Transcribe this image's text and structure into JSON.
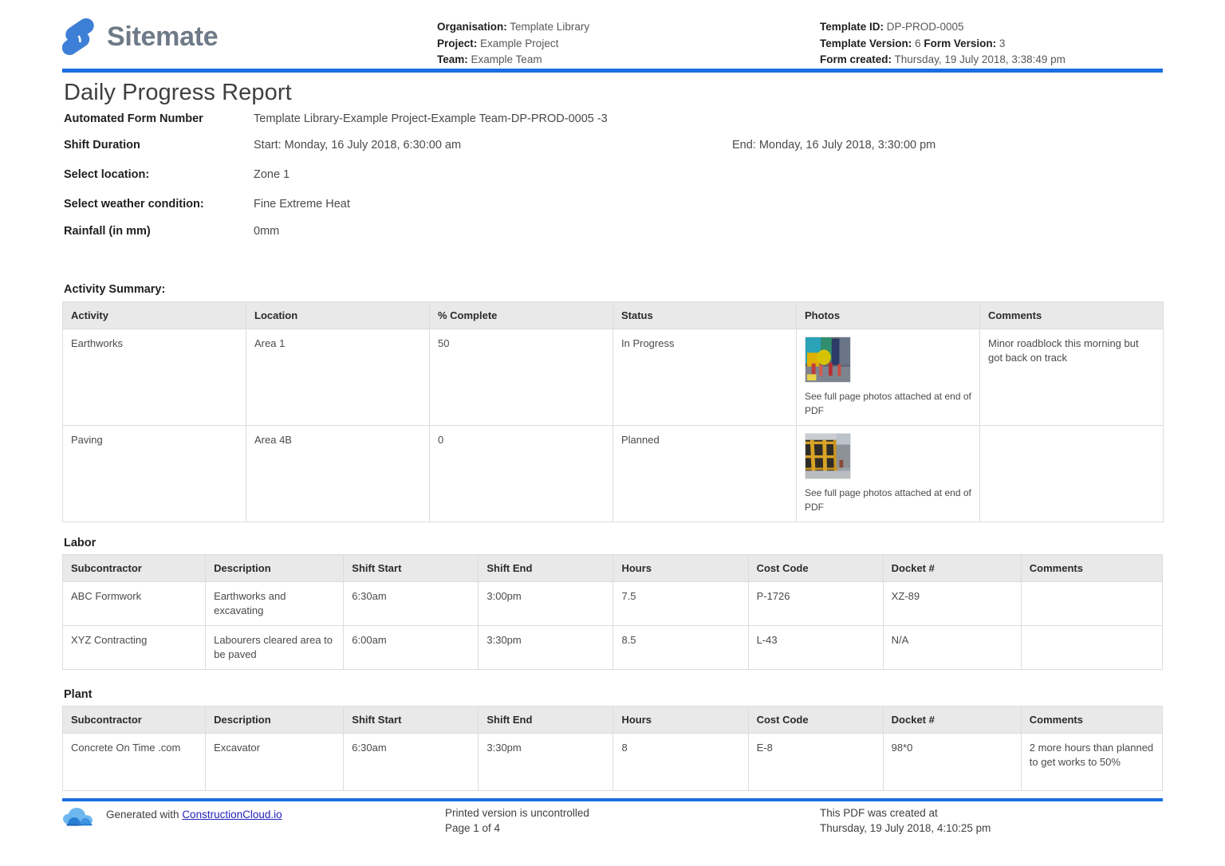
{
  "brand": {
    "name": "Sitemate",
    "mark": "sitemate-logo-mark"
  },
  "header": {
    "left": [
      {
        "label": "Organisation:",
        "value": "Template Library"
      },
      {
        "label": "Project:",
        "value": "Example Project"
      },
      {
        "label": "Team:",
        "value": "Example Team"
      }
    ],
    "right": [
      {
        "label": "Template ID:",
        "value": "DP-PROD-0005"
      },
      {
        "label": "Template Version:",
        "value": "6",
        "label2": "Form Version:",
        "value2": "3"
      },
      {
        "label": "Form created:",
        "value": "Thursday, 19 July 2018, 3:38:49 pm"
      }
    ]
  },
  "document": {
    "title": "Daily Progress Report",
    "fields": [
      {
        "label": "Automated Form Number",
        "value": "Template Library-Example Project-Example Team-DP-PROD-0005   -3"
      },
      {
        "label": "Shift Duration",
        "value": "Start: Monday, 16 July 2018, 6:30:00 am",
        "value_end": "End: Monday, 16 July 2018, 3:30:00 pm"
      },
      {
        "label": "Select location:",
        "value": "Zone 1"
      },
      {
        "label": "Select weather condition:",
        "value": "Fine   Extreme Heat"
      },
      {
        "label": "Rainfall (in mm)",
        "value": "0mm"
      }
    ]
  },
  "activity_summary": {
    "heading": "Activity Summary:",
    "columns": [
      "Activity",
      "Location",
      "% Complete",
      "Status",
      "Photos",
      "Comments"
    ],
    "rows": [
      {
        "activity": "Earthworks",
        "location": "Area 1",
        "percent_complete": "50",
        "status": "In Progress",
        "photo_caption": "See full page photos attached at end of PDF",
        "comments": "Minor roadblock this morning but got back on track"
      },
      {
        "activity": "Paving",
        "location": "Area 4B",
        "percent_complete": "0",
        "status": "Planned",
        "photo_caption": "See full page photos attached at end of PDF",
        "comments": ""
      }
    ]
  },
  "labor": {
    "heading": "Labor",
    "columns": [
      "Subcontractor",
      "Description",
      "Shift Start",
      "Shift End",
      "Hours",
      "Cost Code",
      "Docket #",
      "Comments"
    ],
    "rows": [
      {
        "subcontractor": "ABC Formwork",
        "description": "Earthworks and excavating",
        "shift_start": "6:30am",
        "shift_end": "3:00pm",
        "hours": "7.5",
        "cost_code": "P-1726",
        "docket": "XZ-89",
        "comments": ""
      },
      {
        "subcontractor": "XYZ Contracting",
        "description": "Labourers cleared area to be paved",
        "shift_start": "6:00am",
        "shift_end": "3:30pm",
        "hours": "8.5",
        "cost_code": "L-43",
        "docket": "N/A",
        "comments": ""
      }
    ]
  },
  "plant": {
    "heading": "Plant",
    "columns": [
      "Subcontractor",
      "Description",
      "Shift Start",
      "Shift End",
      "Hours",
      "Cost Code",
      "Docket #",
      "Comments"
    ],
    "rows": [
      {
        "subcontractor": "Concrete On Time .com",
        "description": "Excavator",
        "shift_start": "6:30am",
        "shift_end": "3:30pm",
        "hours": "8",
        "cost_code": "E-8",
        "docket": "98*0",
        "comments": "2 more hours than planned to get works to 50%"
      }
    ]
  },
  "footer": {
    "generated_prefix": "Generated with ",
    "generated_link": "ConstructionCloud.io",
    "printed_line1": "Printed version is uncontrolled",
    "printed_line2": "Page 1 of 4",
    "created_line1": "This PDF was created at",
    "created_line2": "Thursday, 19 July 2018, 4:10:25 pm"
  },
  "colors": {
    "accent_blue": "#1a6fe0",
    "logo_blue": "#3d7fd6",
    "brand_grey": "#6e7a87",
    "table_header_grey": "#e9e9e9",
    "table_border": "#dcdcdc",
    "link_blue": "#2222bb"
  }
}
